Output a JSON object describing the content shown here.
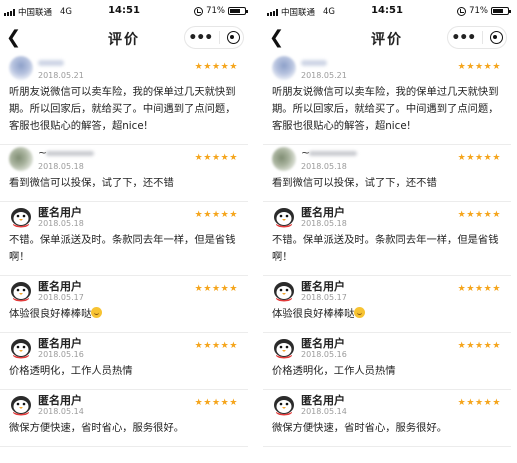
{
  "status": {
    "carrier": "中国联通",
    "network": "4G",
    "time": "14:51",
    "battery": "71%",
    "battery_level": 0.71
  },
  "nav": {
    "back_icon": "chevron-left-icon",
    "title": "评价",
    "more_icon": "more-dots-icon",
    "close_icon": "target-close-icon"
  },
  "colors": {
    "star": "#f5a51c",
    "date": "#9b9b9b"
  },
  "stars": "★★★★★",
  "reviews": [
    {
      "name": "",
      "date": "2018.05.21",
      "text": "听朋友说微信可以卖车险，我的保单过几天就快到期。所以回家后，就给买了。中间遇到了点问题，客服也很贴心的解答，超nice!"
    },
    {
      "name": "~",
      "date": "2018.05.18",
      "text": "看到微信可以投保，试了下，还不错"
    },
    {
      "name": "匿名用户",
      "date": "2018.05.18",
      "text": "不错。保单派送及时。条款同去年一样，但是省钱啊！"
    },
    {
      "name": "匿名用户",
      "date": "2018.05.17",
      "text": "体验很良好棒棒哒"
    },
    {
      "name": "匿名用户",
      "date": "2018.05.16",
      "text": "价格透明化，工作人员热情"
    },
    {
      "name": "匿名用户",
      "date": "2018.05.14",
      "text": "微保方便快速，省时省心，服务很好。"
    }
  ]
}
